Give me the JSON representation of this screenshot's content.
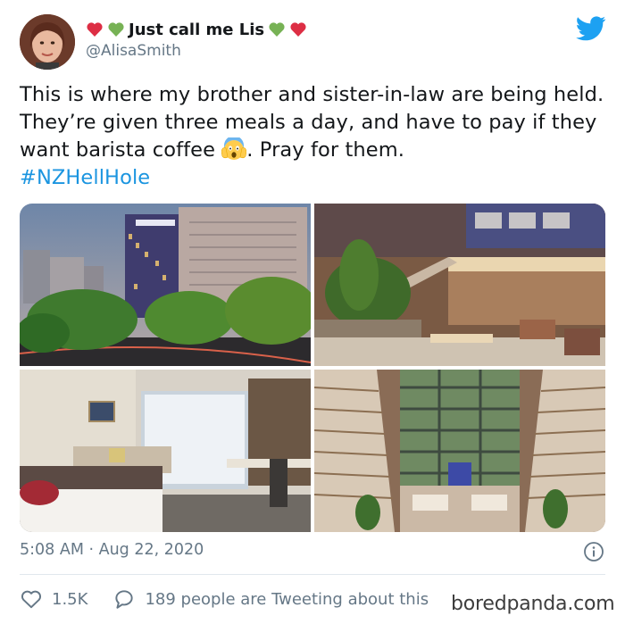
{
  "author": {
    "display_name": "Just call me Lis",
    "handle": "@AlisaSmith",
    "name_emojis": [
      "red-heart",
      "green-heart",
      "green-heart",
      "red-heart"
    ]
  },
  "tweet": {
    "text_main": "This is where my brother and sister-in-law are being held. They’re given three meals a day, and have to pay if they want barista coffee ",
    "emoji": "screaming-face",
    "text_after": ". Pray for them.",
    "hashtag": "#NZHellHole"
  },
  "media": [
    {
      "name": "hotel-exterior-photo"
    },
    {
      "name": "hotel-lobby-photo"
    },
    {
      "name": "hotel-room-photo"
    },
    {
      "name": "hotel-atrium-photo"
    }
  ],
  "meta": {
    "timestamp": "5:08 AM · Aug 22, 2020"
  },
  "actions": {
    "like_count": "1.5K",
    "reply_text": "189 people are Tweeting about this"
  },
  "watermark": "boredpanda.com",
  "colors": {
    "accent": "#1b95e0",
    "secondary_text": "#657786",
    "twitter_blue": "#1da1f2"
  }
}
